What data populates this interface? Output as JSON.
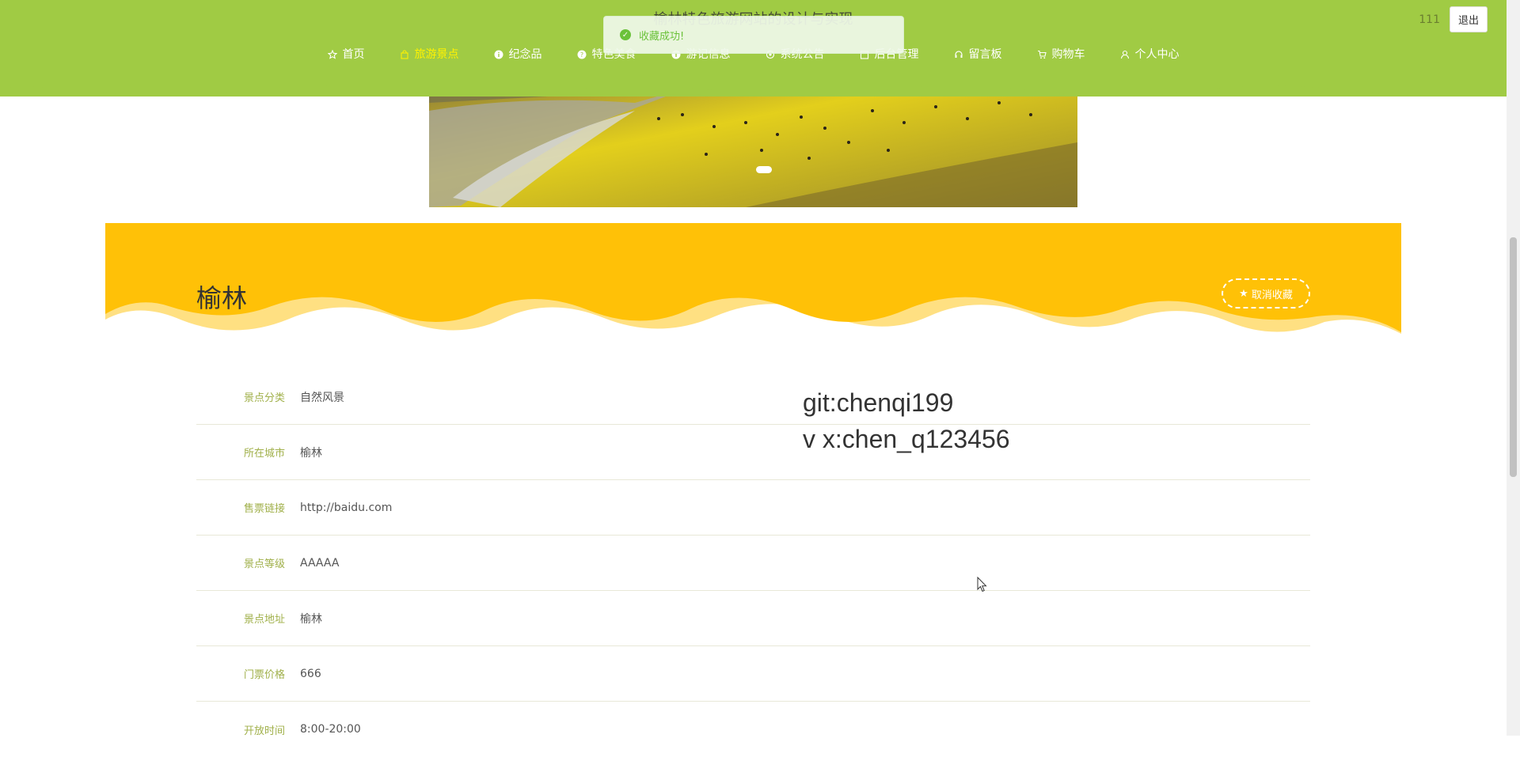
{
  "site": {
    "title": "榆林特色旅游网站的设计与实现"
  },
  "nav": {
    "items": [
      {
        "label": "首页",
        "icon": "star-icon",
        "active": false
      },
      {
        "label": "旅游景点",
        "icon": "bag-icon",
        "active": true
      },
      {
        "label": "纪念品",
        "icon": "info-icon",
        "active": false
      },
      {
        "label": "特色美食",
        "icon": "question-icon",
        "active": false
      },
      {
        "label": "游记信息",
        "icon": "info-icon",
        "active": false
      },
      {
        "label": "系统公告",
        "icon": "gear-icon",
        "active": false
      },
      {
        "label": "后台管理",
        "icon": "calendar-icon",
        "active": false
      },
      {
        "label": "留言板",
        "icon": "headset-icon",
        "active": false
      },
      {
        "label": "购物车",
        "icon": "cart-icon",
        "active": false
      },
      {
        "label": "个人中心",
        "icon": "user-icon",
        "active": false
      }
    ]
  },
  "user": {
    "name": "111",
    "logout_label": "退出"
  },
  "toast": {
    "message": "收藏成功!"
  },
  "detail": {
    "title": "榆林",
    "fav_label": "取消收藏",
    "rows": [
      {
        "label": "景点分类",
        "value": "自然风景"
      },
      {
        "label": "所在城市",
        "value": "榆林"
      },
      {
        "label": "售票链接",
        "value": "http://baidu.com"
      },
      {
        "label": "景点等级",
        "value": "AAAAA"
      },
      {
        "label": "景点地址",
        "value": "榆林"
      },
      {
        "label": "门票价格",
        "value": "666"
      },
      {
        "label": "开放时间",
        "value": "8:00-20:00"
      }
    ]
  },
  "watermark": {
    "line1": "git:chenqi199",
    "line2": "v x:chen_q123456"
  },
  "colors": {
    "nav_bg": "#a0cb44",
    "nav_active": "#fff200",
    "header_bg": "#ffc107",
    "toast_text": "#67c23a",
    "label": "#a0b04a"
  }
}
